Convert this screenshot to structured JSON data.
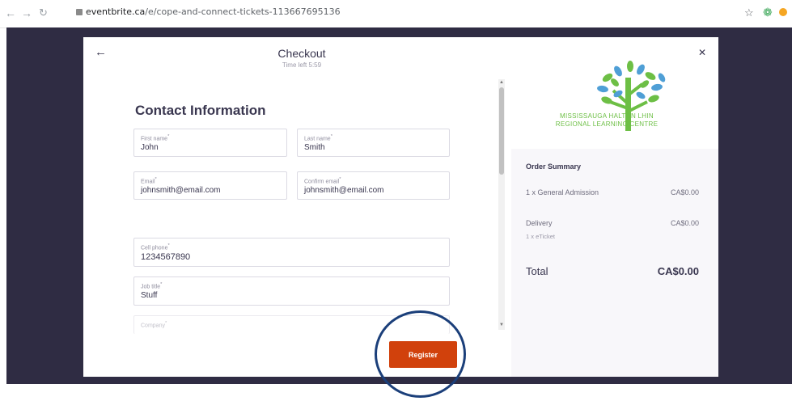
{
  "browser": {
    "url_domain": "eventbrite.ca",
    "url_path": "/e/cope-and-connect-tickets-113667695136",
    "back_icon": "arrow-left-icon",
    "forward_icon": "arrow-right-icon",
    "reload_icon": "reload-icon",
    "lock_icon": "lock-icon",
    "bookmark_icon": "star-icon",
    "extension_icon": "extension-icon"
  },
  "checkout": {
    "title": "Checkout",
    "time_left": "Time left 5:59",
    "back_icon": "arrow-left-icon",
    "close_icon": "close-icon"
  },
  "contact": {
    "heading": "Contact Information",
    "first_name": {
      "label": "First name",
      "value": "John"
    },
    "last_name": {
      "label": "Last name",
      "value": "Smith"
    },
    "email": {
      "label": "Email",
      "value": "johnsmith@email.com"
    },
    "confirm_email": {
      "label": "Confirm email",
      "value": "johnsmith@email.com"
    },
    "cell_phone": {
      "label": "Cell phone",
      "value": "1234567890"
    },
    "job_title": {
      "label": "Job title",
      "value": "Stuff"
    },
    "company": {
      "label": "Company",
      "value": ""
    }
  },
  "register_label": "Register",
  "organizer": {
    "line1": "MISSISSAUGA HALTON LHIN",
    "line2": "REGIONAL LEARNING CENTRE",
    "logo_icon": "tree-logo-icon"
  },
  "order_summary": {
    "title": "Order Summary",
    "items": [
      {
        "label": "1 x General Admission",
        "amount": "CA$0.00"
      }
    ],
    "delivery": {
      "label": "Delivery",
      "sub": "1 x eTicket",
      "amount": "CA$0.00"
    },
    "total_label": "Total",
    "total_amount": "CA$0.00"
  },
  "colors": {
    "brand_orange": "#d1410c",
    "overlay": "#2f2c43",
    "logo_green": "#6dbf45",
    "logo_blue": "#4f9fd6",
    "annotation_circle": "#1b3f7a"
  }
}
